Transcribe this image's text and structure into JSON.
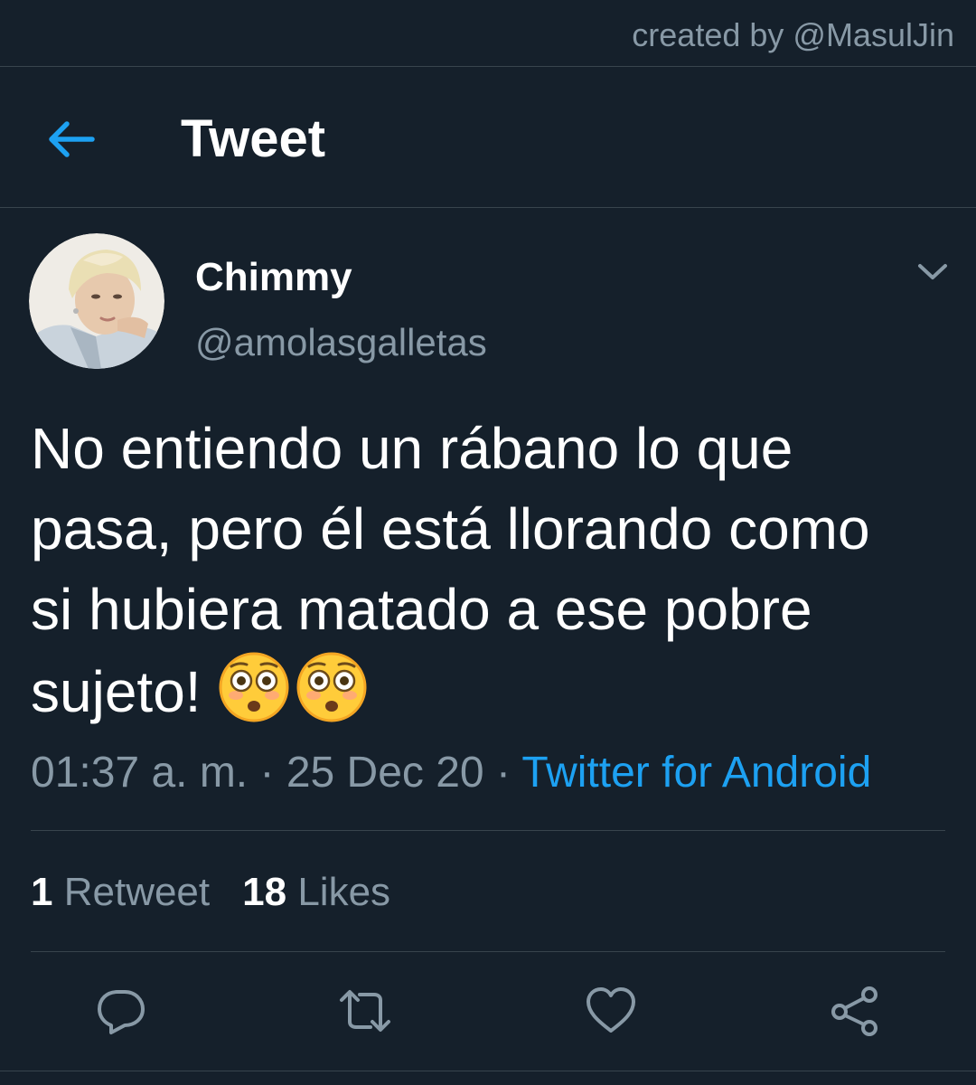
{
  "watermark": "created by @MasulJin",
  "header": {
    "back_icon": "arrow-left-icon",
    "title": "Tweet"
  },
  "tweet": {
    "author": {
      "display_name": "Chimmy",
      "handle": "@amolasgalletas",
      "avatar_icon": "user-avatar-photo"
    },
    "menu_icon": "chevron-down-icon",
    "text_lines": [
      "No entiendo un rábano lo que",
      "pasa, pero él está llorando como",
      "si hubiera matado a ese pobre",
      "sujeto!"
    ],
    "emojis": [
      "flushed-face-emoji",
      "flushed-face-emoji"
    ],
    "time": "01:37 a. m.",
    "separator": "·",
    "date": "25 Dec 20",
    "source": "Twitter for Android",
    "stats": {
      "retweets_count": "1",
      "retweets_label": "Retweet",
      "likes_count": "18",
      "likes_label": "Likes"
    },
    "actions": [
      "reply-icon",
      "retweet-icon",
      "like-icon",
      "share-icon"
    ]
  },
  "colors": {
    "background": "#15202b",
    "divider": "#38444d",
    "secondary_text": "#8899a6",
    "accent": "#1da1f2",
    "primary_text": "#ffffff"
  }
}
